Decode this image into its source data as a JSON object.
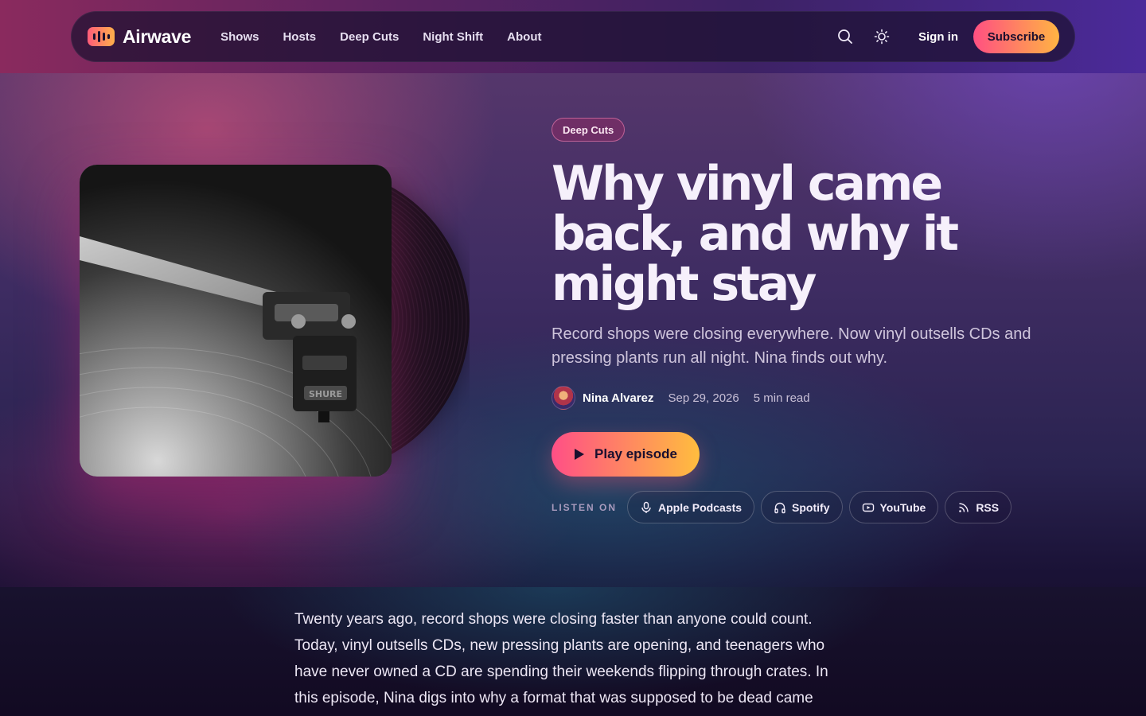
{
  "brand": {
    "name": "Airwave"
  },
  "nav": {
    "links": [
      "Shows",
      "Hosts",
      "Deep Cuts",
      "Night Shift",
      "About"
    ],
    "search_icon": "search-icon",
    "theme_icon": "sun-icon",
    "signin_label": "Sign in",
    "subscribe_label": "Subscribe"
  },
  "episode": {
    "tag": "Deep Cuts",
    "title": "Why vinyl came back, and why it might stay",
    "dek": "Record shops were closing everywhere. Now vinyl outsells CDs and pressing plants run all night. Nina finds out why.",
    "author": "Nina Alvarez",
    "date": "Sep 29, 2026",
    "read_time": "5 min read",
    "play_label": "Play episode",
    "cover_label": "SHURE"
  },
  "listen": {
    "label": "LISTEN ON",
    "platforms": [
      {
        "label": "Apple Podcasts",
        "icon": "microphone-icon"
      },
      {
        "label": "Spotify",
        "icon": "headphones-icon"
      },
      {
        "label": "YouTube",
        "icon": "youtube-icon"
      },
      {
        "label": "RSS",
        "icon": "rss-icon"
      }
    ]
  },
  "article": {
    "intro": "Twenty years ago, record shops were closing faster than anyone could count. Today, vinyl outsells CDs, new pressing plants are opening, and teenagers who have never owned a CD are spending their weekends flipping through crates. In this episode, Nina digs into why a format that was supposed to be dead came"
  },
  "colors": {
    "accent_start": "#ff4f86",
    "accent_end": "#ffbd3e",
    "nav_bg": "#1c1030"
  }
}
